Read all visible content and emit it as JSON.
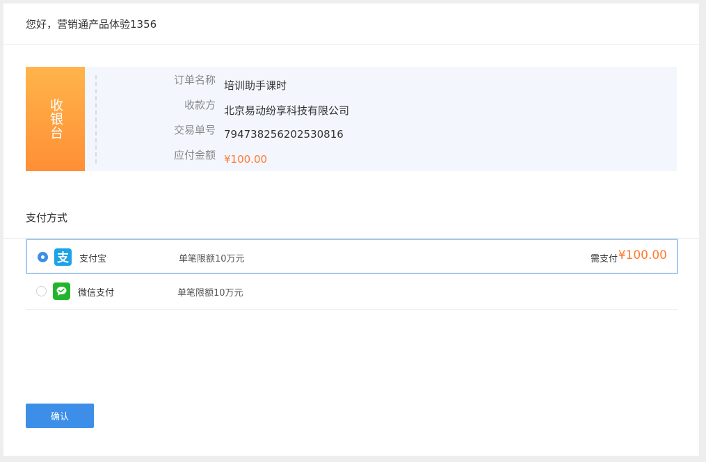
{
  "header": {
    "greeting": "您好，营销通产品体验1356"
  },
  "order": {
    "cashier_tag": "收银台",
    "rows": [
      {
        "label": "订单名称",
        "value": "培训助手课时"
      },
      {
        "label": "收款方",
        "value": "北京易动纷享科技有限公司"
      },
      {
        "label": "交易单号",
        "value": "794738256202530816"
      },
      {
        "label": "应付金额",
        "value": "¥100.00"
      }
    ]
  },
  "payment": {
    "section_title": "支付方式",
    "methods": [
      {
        "name": "支付宝",
        "limit": "单笔限额10万元",
        "selected": true,
        "need_pay_label": "需支付",
        "need_pay_amount": "¥100.00",
        "icon": "alipay-icon"
      },
      {
        "name": "微信支付",
        "limit": "单笔限额10万元",
        "selected": false,
        "icon": "wechat-icon"
      }
    ]
  },
  "actions": {
    "confirm_label": "确认"
  },
  "colors": {
    "accent": "#3d8ee8",
    "price": "#ff7a2f",
    "cashier_gradient_top": "#ffb44a",
    "cashier_gradient_bottom": "#ff8f35",
    "alipay": "#1aa3e8",
    "wechat": "#22b52c"
  }
}
